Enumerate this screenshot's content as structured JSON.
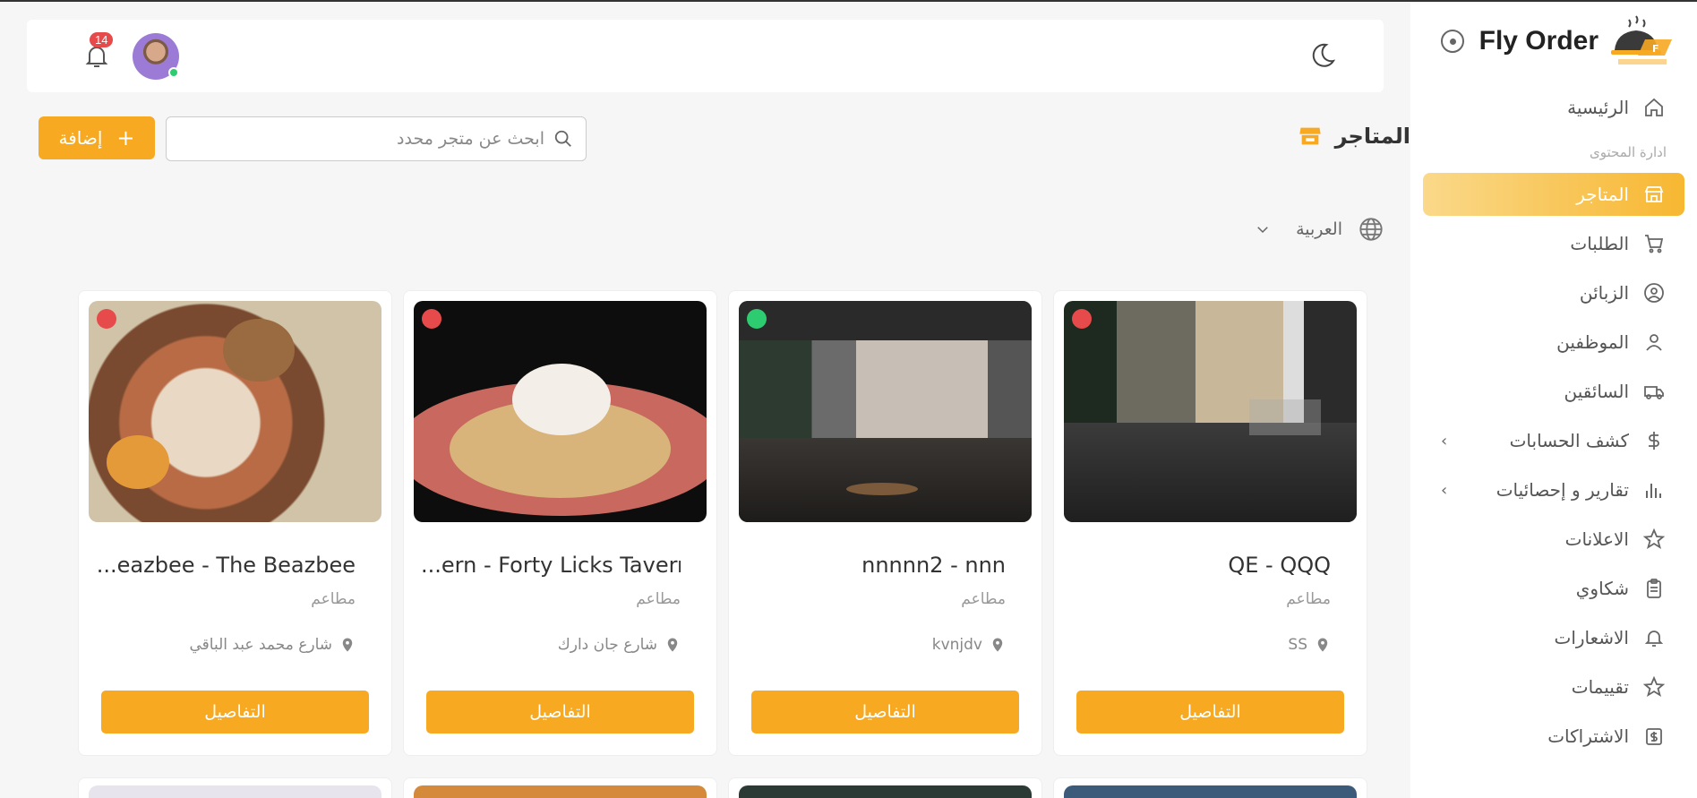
{
  "brand": {
    "title": "Fly Order"
  },
  "sidebar": {
    "section_label": "ادارة المحتوى",
    "items": [
      {
        "label": "الرئيسية",
        "icon": "home-icon"
      },
      {
        "label": "المتاجر",
        "icon": "store-icon",
        "active": true
      },
      {
        "label": "الطلبات",
        "icon": "cart-icon"
      },
      {
        "label": "الزبائن",
        "icon": "user-circle-icon"
      },
      {
        "label": "الموظفين",
        "icon": "user-icon"
      },
      {
        "label": "السائقين",
        "icon": "truck-icon"
      },
      {
        "label": "كشف الحسابات",
        "icon": "dollar-icon",
        "expandable": true
      },
      {
        "label": "تقارير و إحصائيات",
        "icon": "bar-chart-icon",
        "expandable": true
      },
      {
        "label": "الاعلانات",
        "icon": "star-icon"
      },
      {
        "label": "شكاوي",
        "icon": "clipboard-icon"
      },
      {
        "label": "الاشعارات",
        "icon": "bell-icon"
      },
      {
        "label": "تقييمات",
        "icon": "star-icon"
      },
      {
        "label": "الاشتراكات",
        "icon": "money-bill-icon"
      }
    ]
  },
  "topbar": {
    "notification_count": "14"
  },
  "page": {
    "title": "المتاجر",
    "add_label": "إضافة",
    "search_placeholder": "ابحث عن متجر محدد",
    "language": "العربية"
  },
  "stores": [
    {
      "title": "QE - QQQ",
      "category": "مطاعم",
      "address": "SS",
      "status": "inactive",
      "details_label": "التفاصيل"
    },
    {
      "title": "nnnnn2 - nnn",
      "category": "مطاعم",
      "address": "kvnjdv",
      "status": "active",
      "details_label": "التفاصيل"
    },
    {
      "title": "...ern - Forty Licks Tavern",
      "category": "مطاعم",
      "address": "شارع جان دارك",
      "status": "inactive",
      "details_label": "التفاصيل"
    },
    {
      "title": "...eazbee - The Beazbee",
      "category": "مطاعم",
      "address": "شارع محمد عبد الباقي",
      "status": "inactive",
      "details_label": "التفاصيل"
    }
  ],
  "colors": {
    "accent": "#f7a922",
    "active_dot": "#2ecc71",
    "inactive_dot": "#e64a4a"
  }
}
